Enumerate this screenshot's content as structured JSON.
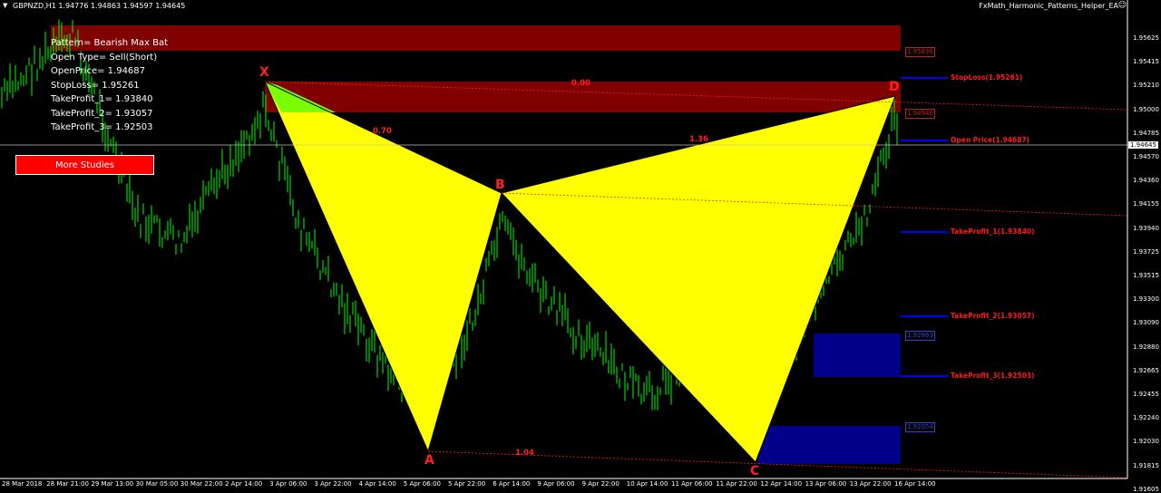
{
  "header": {
    "symbol": "GBPNZD,H1  1.94776 1.94863 1.94597 1.94645",
    "ea_name": "FxMath_Harmonic_Patterns_Helper_EA",
    "smiley": "☺"
  },
  "info": {
    "pattern": "Pattern= Bearish Max Bat",
    "open_type": "Open Type= Sell(Short)",
    "open_price": "OpenPrice= 1.94687",
    "stop_loss": "StopLoss= 1.95261",
    "tp1": "TakeProfit_1= 1.93840",
    "tp2": "TakeProfit_2= 1.93057",
    "tp3": "TakeProfit_3= 1.92503"
  },
  "more_button": "More Studies",
  "pattern_points": {
    "x": "X",
    "a": "A",
    "b": "B",
    "c": "C",
    "d": "D"
  },
  "ratios": {
    "xb": "0.70",
    "bd": "1.36",
    "ac": "1.04",
    "xd": "0.00"
  },
  "levels": {
    "stop_loss": "StopLoss(1.95261)",
    "open_price": "Open Price(1.94687)",
    "tp1": "TakeProfit_1(1.93840)",
    "tp2": "TakeProfit_2(1.93057)",
    "tp3": "TakeProfit_3(1.92503)"
  },
  "zone_labels": {
    "top": "1.95836",
    "prz": "1.94946",
    "mid": "1.92863",
    "bottom": "1.92054"
  },
  "price_axis": {
    "ticks": [
      "1.95625",
      "1.95415",
      "1.95210",
      "1.95000",
      "1.94785",
      "1.94570",
      "1.94360",
      "1.94155",
      "1.93940",
      "1.93725",
      "1.93515",
      "1.93300",
      "1.93090",
      "1.92880",
      "1.92665",
      "1.92455",
      "1.92240",
      "1.92030",
      "1.91815",
      "1.91605"
    ],
    "current": "1.94645"
  },
  "time_axis": [
    "28 Mar 2018",
    "28 Mar 21:00",
    "29 Mar 13:00",
    "30 Mar 05:00",
    "30 Mar 22:00",
    "2 Apr 14:00",
    "3 Apr 06:00",
    "3 Apr 22:00",
    "4 Apr 14:00",
    "5 Apr 06:00",
    "5 Apr 22:00",
    "6 Apr 14:00",
    "9 Apr 06:00",
    "9 Apr 22:00",
    "10 Apr 14:00",
    "11 Apr 06:00",
    "11 Apr 22:00",
    "12 Apr 14:00",
    "13 Apr 06:00",
    "13 Apr 22:00",
    "16 Apr 14:00"
  ],
  "colors": {
    "background": "#000000",
    "candle": "#00ff00",
    "pattern_fill": "#ffff00",
    "zone_red": "#800000",
    "zone_green": "#7cfc00",
    "zone_blue": "#00008b",
    "level_line": "#0000ff",
    "level_text": "#ff1a1a",
    "button": "#ff0000"
  }
}
